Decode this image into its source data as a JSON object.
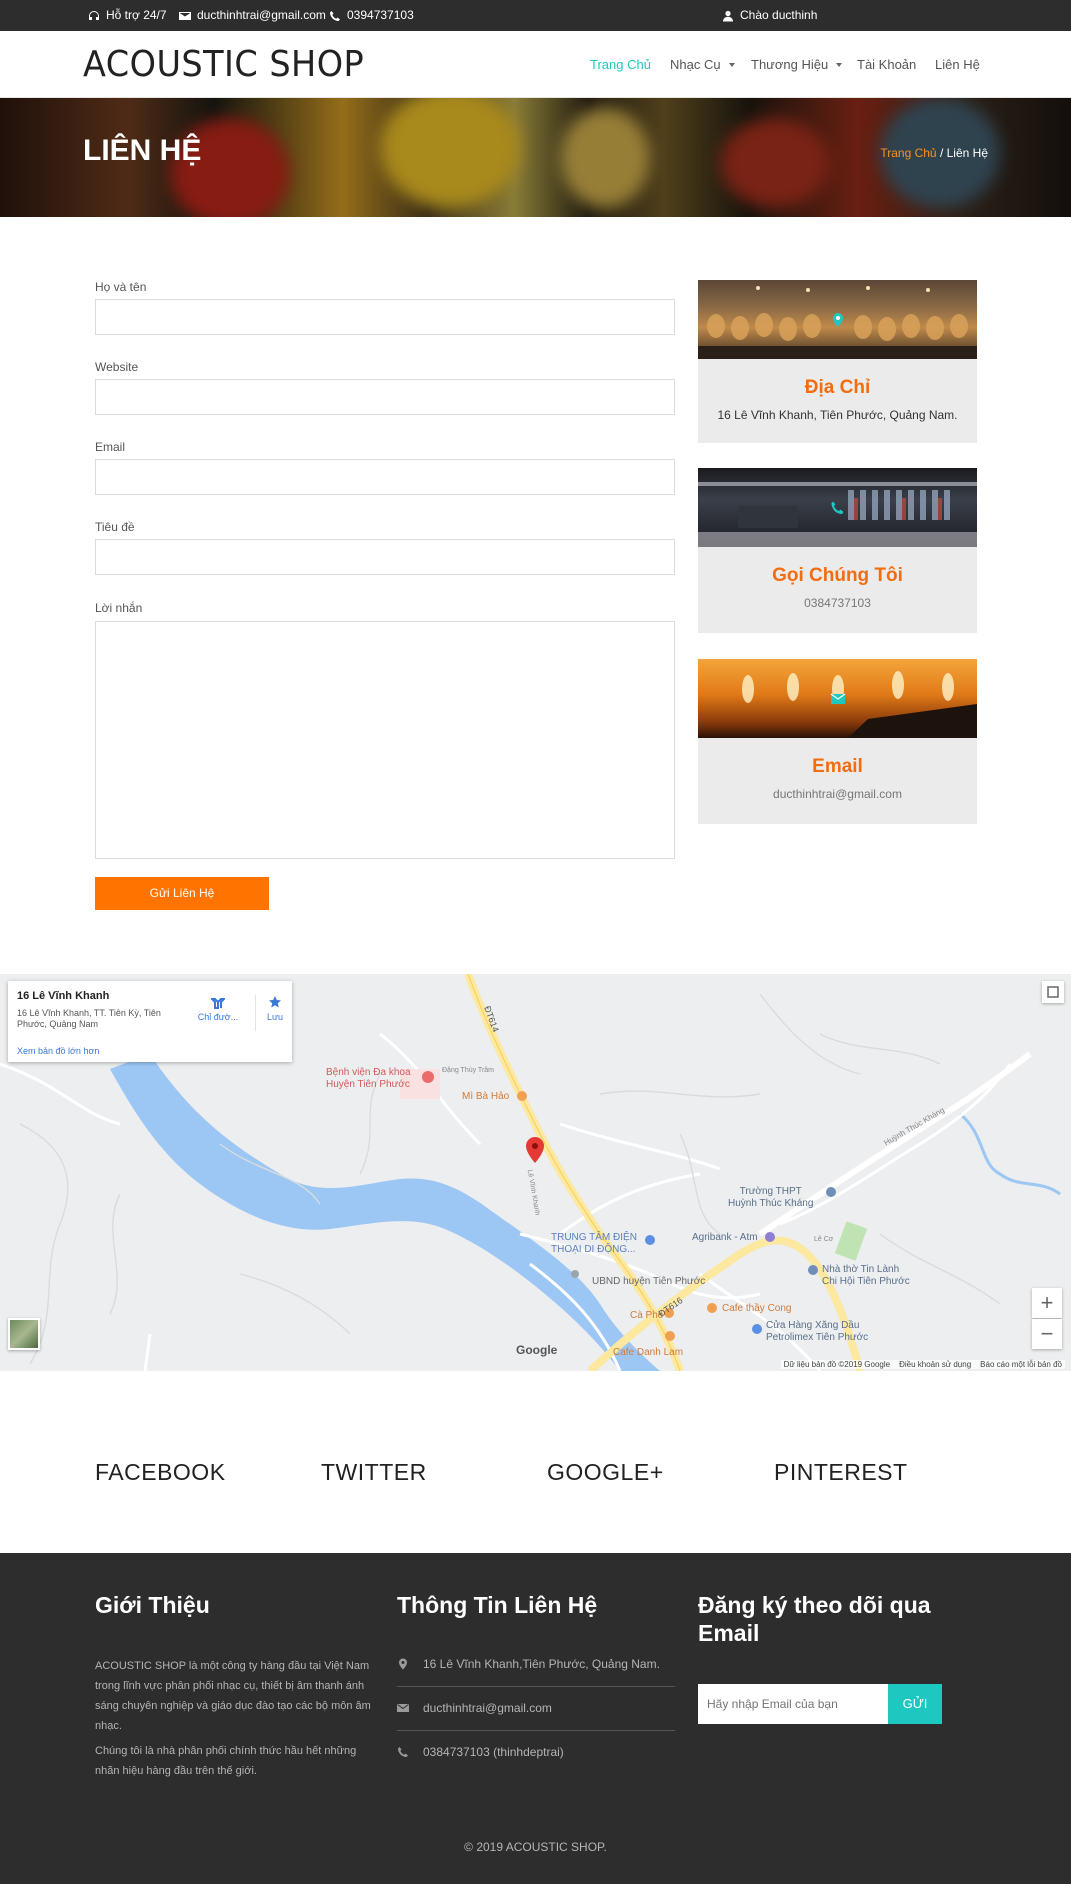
{
  "topbar": {
    "support": "Hỗ trợ 24/7",
    "email": "ducthinhtrai@gmail.com",
    "phone": "0394737103",
    "greeting": "Chào ducthinh"
  },
  "header": {
    "logo": "ACOUSTIC SHOP",
    "nav": [
      "Trang Chủ",
      "Nhạc Cụ",
      "Thương Hiệu",
      "Tài Khoản",
      "Liên Hệ"
    ]
  },
  "banner": {
    "title": "LIÊN HỆ",
    "breadcrumb_home": "Trang Chủ",
    "breadcrumb_sep": "/",
    "breadcrumb_current": "Liên Hệ"
  },
  "form": {
    "name_label": "Họ và tên",
    "website_label": "Website",
    "email_label": "Email",
    "subject_label": "Tiêu đề",
    "message_label": "Lời nhắn",
    "submit_label": "Gửi Liên Hệ"
  },
  "cards": {
    "address": {
      "title": "Địa Chỉ",
      "text": "16 Lê Vĩnh Khanh, Tiên Phước, Quảng Nam."
    },
    "call": {
      "title": "Gọi Chúng Tôi",
      "text": "0384737103"
    },
    "email": {
      "title": "Email",
      "text": "ducthinhtrai@gmail.com"
    }
  },
  "map": {
    "place_title": "16 Lê Vĩnh Khanh",
    "place_address": "16 Lê Vĩnh Khanh, TT. Tiên Kỳ, Tiên Phước, Quảng Nam",
    "directions_label": "Chỉ đườ...",
    "save_label": "Lưu",
    "larger_map": "Xem bản đồ lớn hơn",
    "marker_label": "16 Lê Vĩnh Khanh",
    "labels": {
      "hospital": "Bệnh viện Đa khoa\nHuyện Tiên Phước",
      "dang_thuy_tram": "Đặng Thùy Trâm",
      "mi_ba_hao": "Mì Bà Hảo",
      "road_dt614": "ĐT614",
      "road_dt616": "ĐT616",
      "huynh_thuc_khang_road": "Huỳnh Thúc Kháng",
      "school": "Trường THPT\nHuỳnh Thúc Kháng",
      "agribank": "Agribank - Atm",
      "phone_center": "TRUNG TÂM ĐIỆN\nTHOẠI DI ĐỘNG...",
      "ubnd": "UBND huyện Tiên Phước",
      "church": "Nhà thờ Tin Lành\nChi Hội Tiên Phước",
      "cafe_thay_cong": "Cafe thầy Cong",
      "ca_phe": "Cà Phê",
      "gas_station": "Cửa Hàng Xăng Dầu\nPetrolimex Tiên Phước",
      "cafe_danh_lam": "Cafe Danh Lam",
      "le_vinh_khanh_road": "Lê Vĩnh Khanh",
      "le_coi": "Lê Cơ",
      "google": "Google"
    },
    "attribution": [
      "Dữ liệu bản đồ ©2019 Google",
      "Điều khoản sử dụng",
      "Báo cáo một lỗi bản đồ"
    ]
  },
  "social": [
    "FACEBOOK",
    "TWITTER",
    "GOOGLE+",
    "PINTEREST"
  ],
  "footer": {
    "about_title": "Giới Thiệu",
    "about_p1": "ACOUSTIC SHOP là một công ty hàng đầu tại Việt Nam trong lĩnh vực phân phối nhạc cụ, thiết bị âm thanh ánh sáng chuyên nghiệp và giáo dục đào tạo các bộ môn âm nhạc.",
    "about_p2": "Chúng tôi là nhà phân phối chính thức hầu hết những nhãn hiệu hàng đầu trên thế giới.",
    "contact_title": "Thông Tin Liên Hệ",
    "contact_address": "16 Lê Vĩnh Khanh,Tiên Phước, Quảng Nam.",
    "contact_email": "ducthinhtrai@gmail.com",
    "contact_phone": "0384737103 (thinhdeptrai)",
    "subscribe_title": "Đăng ký theo dõi qua Email",
    "subscribe_placeholder": "Hãy nhập Email của bạn",
    "subscribe_button": "GỬI",
    "copyright": "© 2019 ACOUSTIC SHOP."
  },
  "colors": {
    "accent_orange": "#ff7400",
    "accent_teal": "#1fc7c1",
    "dark": "#2d2d2d"
  }
}
